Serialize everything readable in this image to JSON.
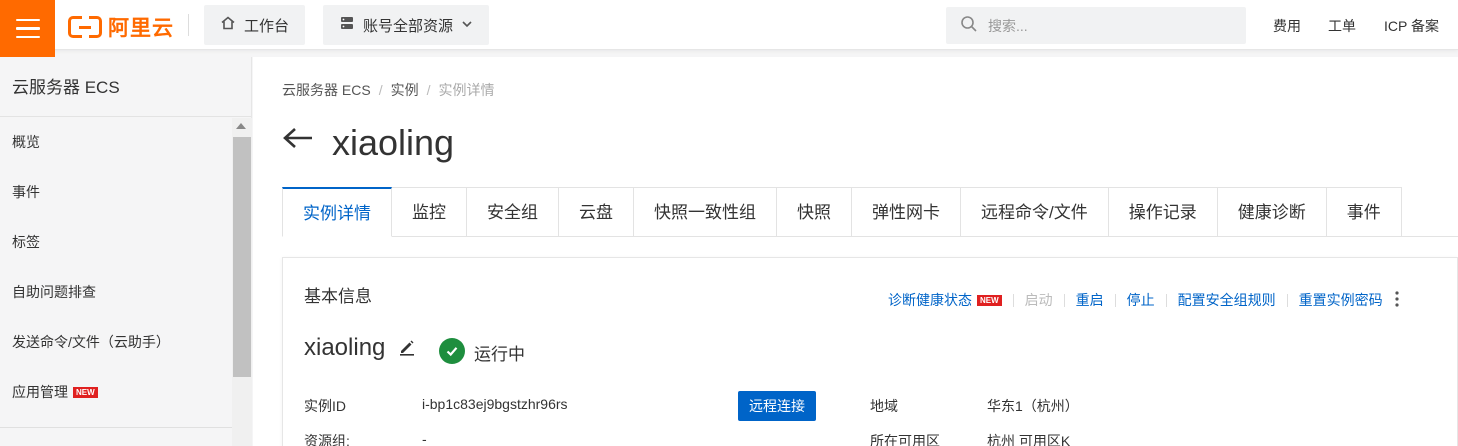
{
  "topbar": {
    "logo_text": "阿里云",
    "workbench_label": "工作台",
    "resources_label": "账号全部资源",
    "search_placeholder": "搜索...",
    "links": [
      "费用",
      "工单",
      "ICP 备案"
    ],
    "accent_color": "#ff6a00"
  },
  "sidebar": {
    "title": "云服务器 ECS",
    "items": [
      {
        "label": "概览"
      },
      {
        "label": "事件"
      },
      {
        "label": "标签"
      },
      {
        "label": "自助问题排查"
      },
      {
        "label": "发送命令/文件（云助手）"
      },
      {
        "label": "应用管理",
        "badge": "NEW"
      }
    ]
  },
  "breadcrumb": [
    "云服务器 ECS",
    "实例",
    "实例详情"
  ],
  "page_title": "xiaoling",
  "tabs": [
    "实例详情",
    "监控",
    "安全组",
    "云盘",
    "快照一致性组",
    "快照",
    "弹性网卡",
    "远程命令/文件",
    "操作记录",
    "健康诊断",
    "事件"
  ],
  "active_tab": "实例详情",
  "basic_info": {
    "title": "基本信息",
    "actions": {
      "diagnose": "诊断健康状态",
      "diagnose_badge": "NEW",
      "start": "启动",
      "restart": "重启",
      "stop": "停止",
      "config_sg": "配置安全组规则",
      "reset_pwd": "重置实例密码"
    },
    "instance_name": "xiaoling",
    "status": "运行中",
    "status_color": "#1e8e3e",
    "fields": {
      "instance_id_label": "实例ID",
      "instance_id": "i-bp1c83ej9bgstzhr96rs",
      "remote_connect": "远程连接",
      "region_label": "地域",
      "region": "华东1（杭州）",
      "resource_group_label": "资源组:",
      "resource_group": "-",
      "zone_label": "所在可用区",
      "zone": "杭州 可用区K"
    }
  }
}
